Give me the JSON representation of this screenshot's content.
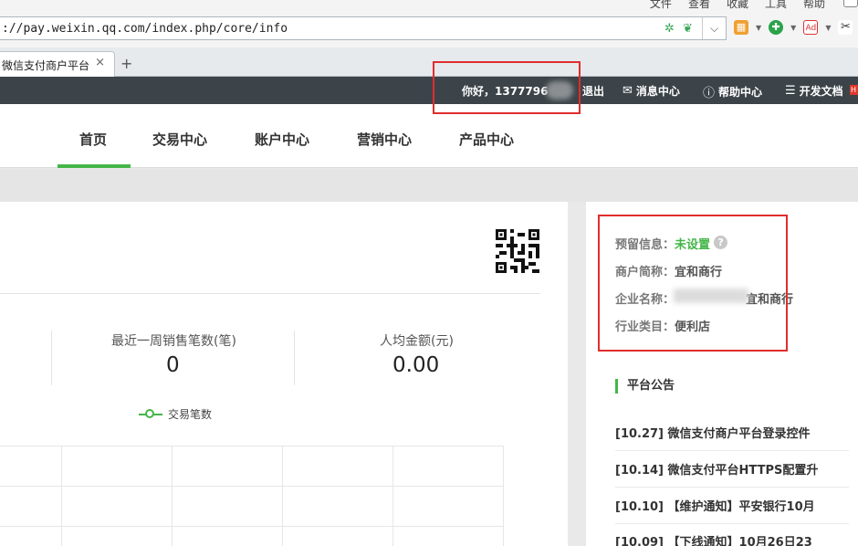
{
  "browser": {
    "menu": [
      "文件",
      "查看",
      "收藏",
      "工具",
      "帮助"
    ],
    "url": "://pay.weixin.qq.com/index.php/core/info",
    "tab_title": "微信支付商户平台",
    "tab_close": "×",
    "new_tab": "+"
  },
  "topbar": {
    "greeting": "你好，1377796",
    "logout": "退出",
    "messages": "消息中心",
    "help": "帮助中心",
    "docs": "开发文档"
  },
  "nav": {
    "items": [
      "首页",
      "交易中心",
      "账户中心",
      "营销中心",
      "产品中心"
    ],
    "active": 0
  },
  "stats": [
    {
      "label": "最近一周销售笔数(笔)",
      "value": "0"
    },
    {
      "label": "人均金额(元)",
      "value": "0.00"
    }
  ],
  "chart_data": {
    "type": "line",
    "legend": [
      "交易笔数"
    ],
    "series": [
      {
        "name": "交易笔数",
        "values": []
      }
    ]
  },
  "merchant": {
    "reserved_label": "预留信息：",
    "reserved_value": "未设置",
    "short_name_label": "商户简称：",
    "short_name_value": "宜和商行",
    "company_label": "企业名称：",
    "company_value": "宜和商行",
    "industry_label": "行业类目：",
    "industry_value": "便利店"
  },
  "notices": {
    "title": "平台公告",
    "items": [
      "[10.27] 微信支付商户平台登录控件",
      "[10.14] 微信支付平台HTTPS配置升",
      "[10.10] 【维护通知】平安银行10月",
      "[10.09] 【下线通知】10月26日23"
    ]
  },
  "colors": {
    "accent": "#44b549",
    "topbar": "#3c4449",
    "annotation": "#e02d2d"
  }
}
